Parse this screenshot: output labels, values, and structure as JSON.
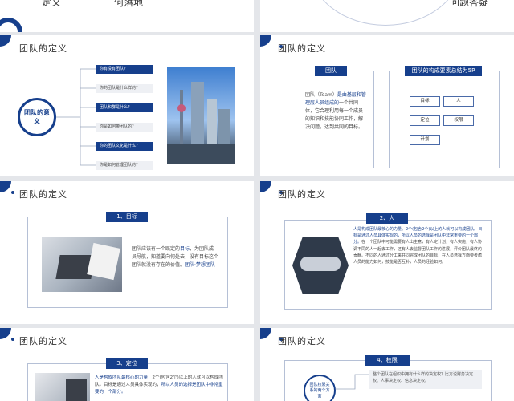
{
  "top_left": {
    "word1": "定义",
    "word2": "何落地"
  },
  "top_right": {
    "word": "问题答疑"
  },
  "section_title": "团队的定义",
  "s1": {
    "circle": "团队的意义",
    "questions": [
      "你有没有团队?",
      "你的团队是什么样的?",
      "团队和群是什么?",
      "你是如何带团队的?",
      "你的团队文化是什么?",
      "你是如何管理团队的?"
    ]
  },
  "s2": {
    "left_header": "团队",
    "left_text_lead": "团队（Team）",
    "left_text_blue": "是由基层和管理层人员组成的",
    "left_text_rest": "一个共同体，它合理利用每一个成员的知识和技能协同工作，解决问题，达到共同的目标。",
    "right_header": "团队的构成要素总结为5P",
    "tags": [
      "目标",
      "人",
      "定位",
      "权限",
      "计划"
    ]
  },
  "s3": {
    "header": "1、目标",
    "text_a": "团队应该有一个既定的",
    "text_b": "目标",
    "text_c": "，为团队成员导航，知道要向何处去，没有目标这个团队就没有存在的价值。",
    "text_d": "团队·梦想团队"
  },
  "s4": {
    "header": "2、人",
    "lines_blue": "人是构成团队最核心的力量。2个(包含2个)以上的人就可以构成团队。目标是通过人员具体实现的，所以人员的选择是团队中非常重要的一个部分。",
    "lines_rest": "在一个团队中可能需要有人出主意，有人定计划，有人实施，有人协调不同的人一起去工作，还有人去监督团队工作的进展，评价团队最终的贡献。不同的人通过分工来共同完成团队的目标，在人员选择方面要考虑人员的能力如何，技能是否互补，人员的经验如何。"
  },
  "s5": {
    "header": "3、定位",
    "text_blue": "人是构成团队最核心的力量，",
    "text_rest": "2个(包含2个)以上的人就可以构成团队。目标是通过人员具体实现的，",
    "text_blue2": "所以人员的选择是团队中非常重要的一个部分。"
  },
  "s6": {
    "header": "4、权限",
    "circle": "团队权限关系的两个方面",
    "text": "整个团队在组织中拥有什么样的决定权？比方说财务决定权、人事决定权、信息决定权。"
  }
}
